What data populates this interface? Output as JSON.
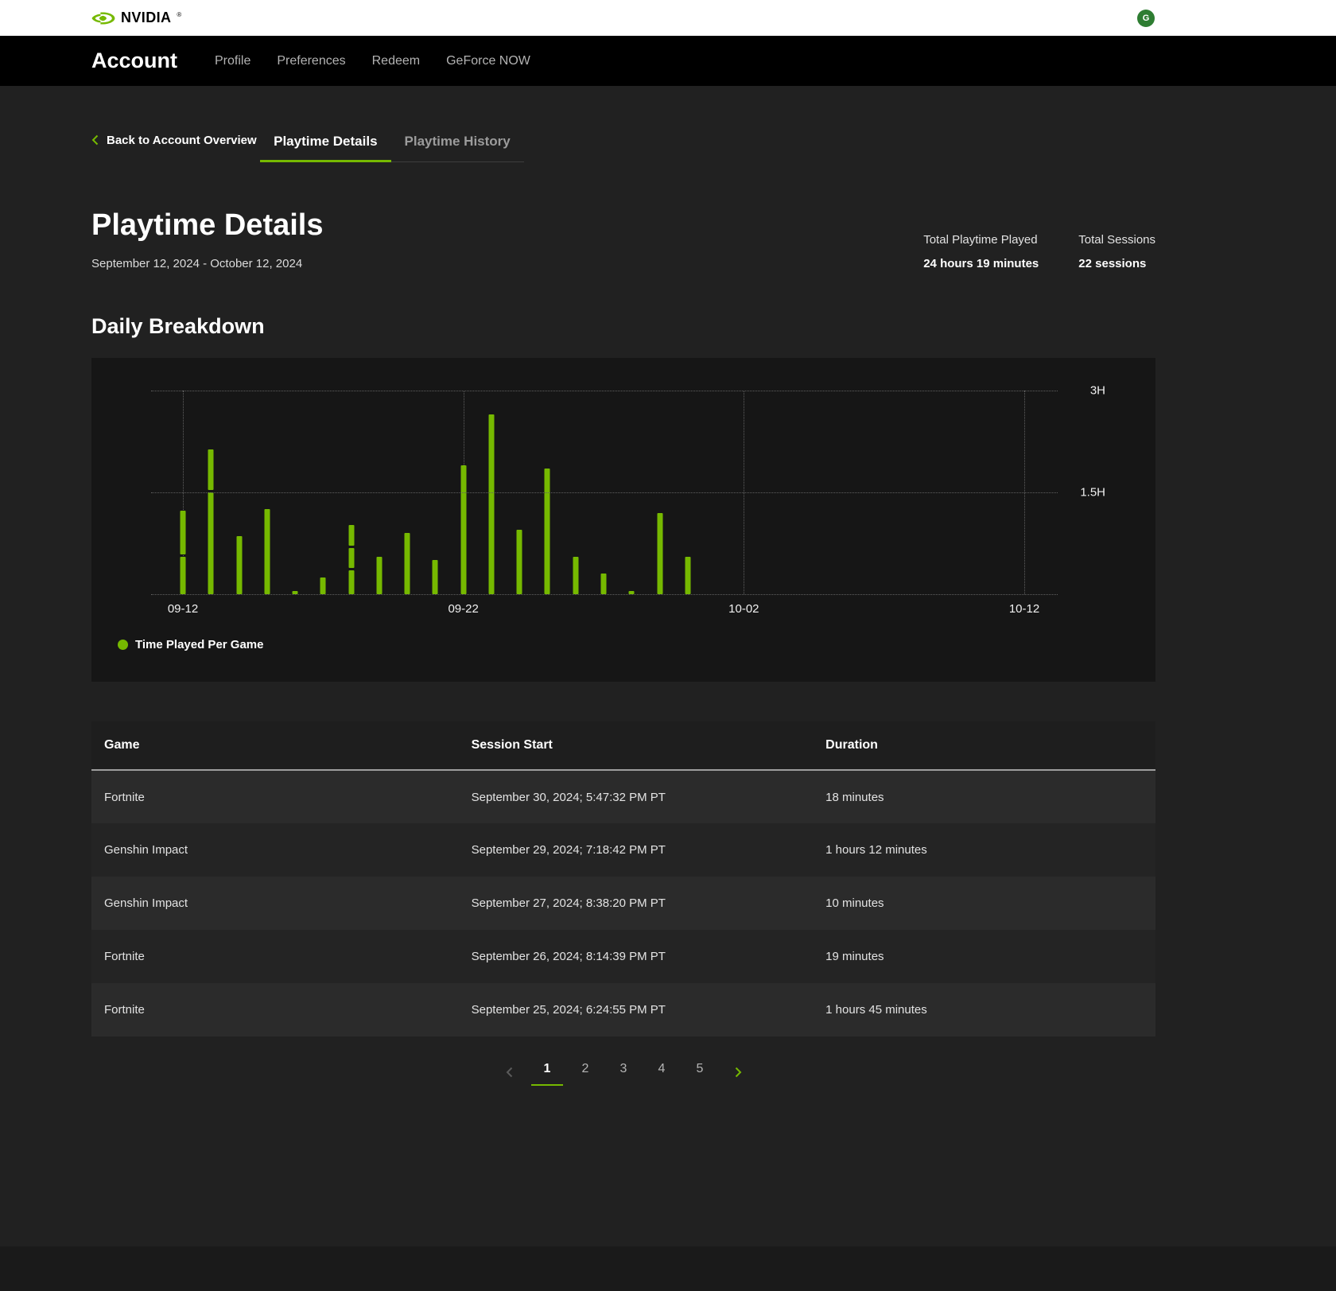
{
  "brand": {
    "logo_text": "NVIDIA",
    "logo_mark": "®",
    "nvidia_green": "#76b900",
    "avatar_initial": "G"
  },
  "nav": {
    "title": "Account",
    "items": [
      "Profile",
      "Preferences",
      "Redeem",
      "GeForce NOW"
    ]
  },
  "back_link": "Back to Account Overview",
  "tabs": [
    {
      "label": "Playtime Details",
      "active": true
    },
    {
      "label": "Playtime History",
      "active": false
    }
  ],
  "page": {
    "title": "Playtime Details",
    "date_range": "September 12, 2024 - October 12, 2024",
    "stats": [
      {
        "label": "Total Playtime Played",
        "value": "24 hours 19 minutes"
      },
      {
        "label": "Total Sessions",
        "value": "22 sessions"
      }
    ],
    "section_title": "Daily Breakdown"
  },
  "chart_data": {
    "type": "bar",
    "title": "Daily Breakdown",
    "unit": "hours",
    "ylim": [
      0,
      3
    ],
    "days_span": 30,
    "grid": "dotted",
    "legend": "Time Played Per Game",
    "legend_position": "bottom-left",
    "bar_color": "#76b900",
    "y_ticks": [
      {
        "label": "1.5H",
        "value": 1.5
      },
      {
        "label": "3H",
        "value": 3
      }
    ],
    "x_ticks": [
      {
        "label": "09-12",
        "day": 0
      },
      {
        "label": "09-22",
        "day": 10
      },
      {
        "label": "10-02",
        "day": 20
      },
      {
        "label": "10-12",
        "day": 30
      }
    ],
    "bars": [
      {
        "date": "09-12",
        "day": 0,
        "segments": [
          0.55,
          0.65
        ]
      },
      {
        "date": "09-13",
        "day": 1,
        "segments": [
          1.5,
          0.6
        ]
      },
      {
        "date": "09-14",
        "day": 2,
        "segments": [
          0.85
        ]
      },
      {
        "date": "09-15",
        "day": 3,
        "segments": [
          1.25
        ]
      },
      {
        "date": "09-16",
        "day": 4,
        "segments": [
          0.05
        ]
      },
      {
        "date": "09-17",
        "day": 5,
        "segments": [
          0.25
        ]
      },
      {
        "date": "09-18",
        "day": 6,
        "segments": [
          0.35,
          0.3,
          0.3
        ]
      },
      {
        "date": "09-19",
        "day": 7,
        "segments": [
          0.55
        ]
      },
      {
        "date": "09-20",
        "day": 8,
        "segments": [
          0.9
        ]
      },
      {
        "date": "09-21",
        "day": 9,
        "segments": [
          0.5
        ]
      },
      {
        "date": "09-22",
        "day": 10,
        "segments": [
          1.9
        ]
      },
      {
        "date": "09-23",
        "day": 11,
        "segments": [
          2.65
        ]
      },
      {
        "date": "09-24",
        "day": 12,
        "segments": [
          0.95
        ]
      },
      {
        "date": "09-25",
        "day": 13,
        "segments": [
          1.85
        ]
      },
      {
        "date": "09-26",
        "day": 14,
        "segments": [
          0.55
        ]
      },
      {
        "date": "09-27",
        "day": 15,
        "segments": [
          0.3
        ]
      },
      {
        "date": "09-28",
        "day": 16,
        "segments": [
          0.05
        ]
      },
      {
        "date": "09-29",
        "day": 17,
        "segments": [
          1.2
        ]
      },
      {
        "date": "09-30",
        "day": 18,
        "segments": [
          0.55
        ]
      }
    ]
  },
  "table": {
    "columns": [
      "Game",
      "Session Start",
      "Duration"
    ],
    "rows": [
      {
        "game": "Fortnite",
        "session_start": "September 30, 2024; 5:47:32 PM PT",
        "duration": "18 minutes"
      },
      {
        "game": "Genshin Impact",
        "session_start": "September 29, 2024; 7:18:42 PM PT",
        "duration": "1 hours 12 minutes"
      },
      {
        "game": "Genshin Impact",
        "session_start": "September 27, 2024; 8:38:20 PM PT",
        "duration": "10 minutes"
      },
      {
        "game": "Fortnite",
        "session_start": "September 26, 2024; 8:14:39 PM PT",
        "duration": "19 minutes"
      },
      {
        "game": "Fortnite",
        "session_start": "September 25, 2024; 6:24:55 PM PT",
        "duration": "1 hours 45 minutes"
      }
    ]
  },
  "pagination": {
    "prev_enabled": false,
    "pages": [
      "1",
      "2",
      "3",
      "4",
      "5"
    ],
    "active_page": "1",
    "next_enabled": true
  }
}
